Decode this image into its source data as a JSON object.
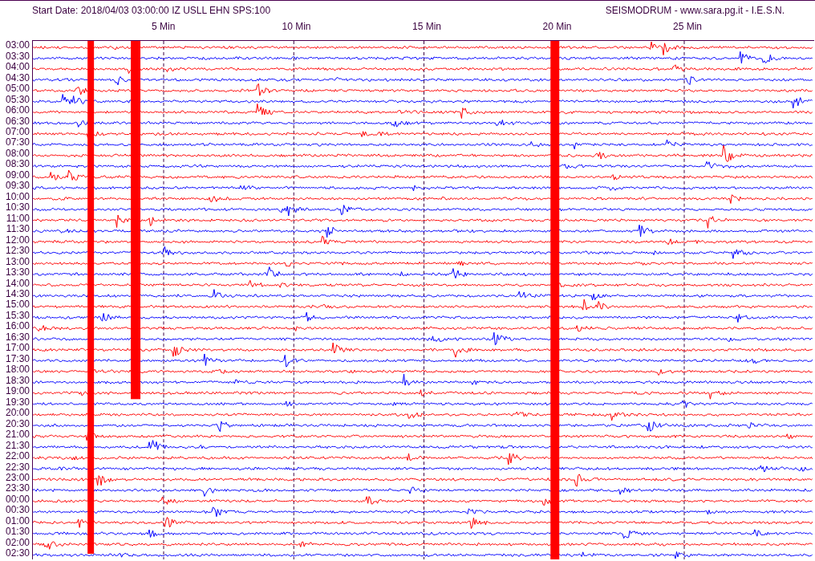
{
  "header": {
    "start_info": "Start Date: 2018/04/03 03:00:00 IZ USLL EHN SPS:100",
    "source": "SEISMODRUM - www.sara.pg.it - I.E.S.N."
  },
  "minute_marks": [
    "5 Min",
    "10 Min",
    "15 Min",
    "20 Min",
    "25 Min"
  ],
  "rows": [
    {
      "time": "03:00",
      "color": "#ff0000"
    },
    {
      "time": "03:30",
      "color": "#0000ff"
    },
    {
      "time": "04:00",
      "color": "#ff0000"
    },
    {
      "time": "04:30",
      "color": "#0000ff"
    },
    {
      "time": "05:00",
      "color": "#ff0000"
    },
    {
      "time": "05:30",
      "color": "#0000ff"
    },
    {
      "time": "06:00",
      "color": "#ff0000"
    },
    {
      "time": "06:30",
      "color": "#0000ff"
    },
    {
      "time": "07:00",
      "color": "#ff0000"
    },
    {
      "time": "07:30",
      "color": "#0000ff"
    },
    {
      "time": "08:00",
      "color": "#ff0000"
    },
    {
      "time": "08:30",
      "color": "#0000ff"
    },
    {
      "time": "09:00",
      "color": "#ff0000"
    },
    {
      "time": "09:30",
      "color": "#0000ff"
    },
    {
      "time": "10:00",
      "color": "#ff0000"
    },
    {
      "time": "10:30",
      "color": "#0000ff"
    },
    {
      "time": "11:00",
      "color": "#ff0000"
    },
    {
      "time": "11:30",
      "color": "#0000ff"
    },
    {
      "time": "12:00",
      "color": "#ff0000"
    },
    {
      "time": "12:30",
      "color": "#0000ff"
    },
    {
      "time": "13:00",
      "color": "#ff0000"
    },
    {
      "time": "13:30",
      "color": "#0000ff"
    },
    {
      "time": "14:00",
      "color": "#ff0000"
    },
    {
      "time": "14:30",
      "color": "#0000ff"
    },
    {
      "time": "15:00",
      "color": "#ff0000"
    },
    {
      "time": "15:30",
      "color": "#0000ff"
    },
    {
      "time": "16:00",
      "color": "#ff0000"
    },
    {
      "time": "16:30",
      "color": "#0000ff"
    },
    {
      "time": "17:00",
      "color": "#ff0000"
    },
    {
      "time": "17:30",
      "color": "#0000ff"
    },
    {
      "time": "18:00",
      "color": "#ff0000"
    },
    {
      "time": "18:30",
      "color": "#0000ff"
    },
    {
      "time": "19:00",
      "color": "#ff0000"
    },
    {
      "time": "19:30",
      "color": "#0000ff"
    },
    {
      "time": "20:00",
      "color": "#ff0000"
    },
    {
      "time": "20:30",
      "color": "#0000ff"
    },
    {
      "time": "21:00",
      "color": "#ff0000"
    },
    {
      "time": "21:30",
      "color": "#0000ff"
    },
    {
      "time": "22:00",
      "color": "#ff0000"
    },
    {
      "time": "22:30",
      "color": "#0000ff"
    },
    {
      "time": "23:00",
      "color": "#ff0000"
    },
    {
      "time": "23:30",
      "color": "#0000ff"
    },
    {
      "time": "00:00",
      "color": "#ff0000"
    },
    {
      "time": "00:30",
      "color": "#0000ff"
    },
    {
      "time": "01:00",
      "color": "#ff0000"
    },
    {
      "time": "01:30",
      "color": "#0000ff"
    },
    {
      "time": "02:00",
      "color": "#ff0000"
    },
    {
      "time": "02:30",
      "color": "#0000ff"
    }
  ]
}
